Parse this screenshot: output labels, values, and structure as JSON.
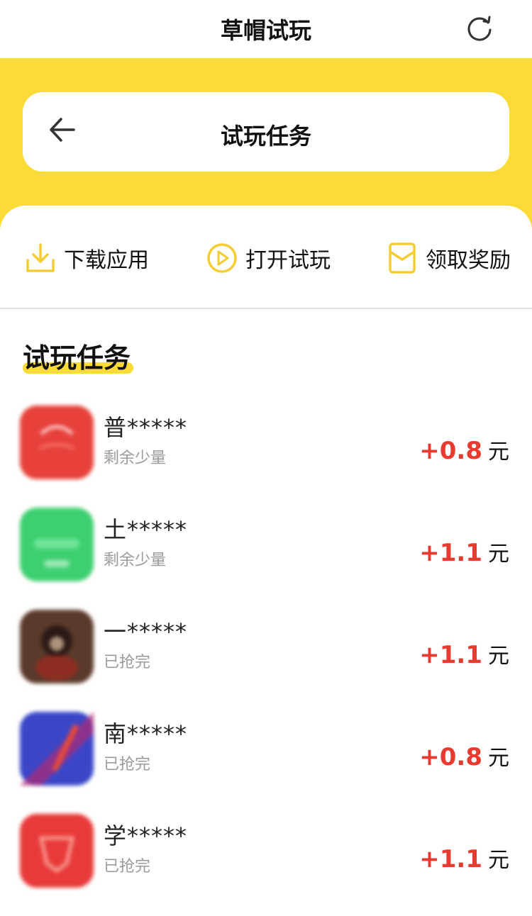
{
  "app_title": "草帽试玩",
  "header": {
    "title": "试玩任务"
  },
  "steps": [
    {
      "label": "下载应用",
      "icon": "download-icon"
    },
    {
      "label": "打开试玩",
      "icon": "play-circle-icon"
    },
    {
      "label": "领取奖励",
      "icon": "red-envelope-icon"
    }
  ],
  "section_title": "试玩任务",
  "tasks": [
    {
      "name": "普*****",
      "status": "剩余少量",
      "amount": "+0.8",
      "unit": "元",
      "icon_color": "#e8413c"
    },
    {
      "name": "土*****",
      "status": "剩余少量",
      "amount": "+1.1",
      "unit": "元",
      "icon_color": "#3ed070"
    },
    {
      "name": "一*****",
      "status": "已抢完",
      "amount": "+1.1",
      "unit": "元",
      "icon_color": "#5a3a2a"
    },
    {
      "name": "南*****",
      "status": "已抢完",
      "amount": "+0.8",
      "unit": "元",
      "icon_color": "#3a46c8"
    },
    {
      "name": "学*****",
      "status": "已抢完",
      "amount": "+1.1",
      "unit": "元",
      "icon_color": "#e83a3a"
    }
  ],
  "colors": {
    "accent_yellow": "#fbdb35",
    "reward_red": "#e83a2e",
    "muted_gray": "#9a9a9a"
  }
}
